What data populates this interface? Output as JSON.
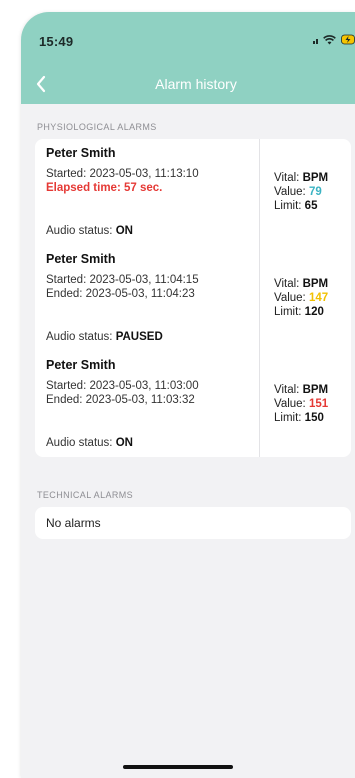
{
  "status_bar": {
    "time": "15:49"
  },
  "nav": {
    "title": "Alarm history"
  },
  "sections": {
    "physiological": "PHYSIOLOGICAL ALARMS",
    "technical": "TECHNICAL ALARMS"
  },
  "alarms": [
    {
      "name": "Peter Smith",
      "started": "Started: 2023-05-03, 11:13:10",
      "second_line": "Elapsed time: 57 sec.",
      "audio_label": "Audio status: ",
      "audio_value": "ON",
      "vital_label": "Vital: ",
      "vital": "BPM",
      "value_label": "Value: ",
      "value": "79",
      "value_color": "#3bb3c3",
      "limit_label": "Limit: ",
      "limit": "65"
    },
    {
      "name": "Peter Smith",
      "started": "Started: 2023-05-03, 11:04:15",
      "second_line": "Ended: 2023-05-03, 11:04:23",
      "audio_label": "Audio status: ",
      "audio_value": "PAUSED",
      "vital_label": "Vital: ",
      "vital": "BPM",
      "value_label": "Value: ",
      "value": "147",
      "value_color": "#f2c100",
      "limit_label": "Limit: ",
      "limit": "120"
    },
    {
      "name": "Peter Smith",
      "started": "Started: 2023-05-03, 11:03:00",
      "second_line": "Ended: 2023-05-03, 11:03:32",
      "audio_label": "Audio status: ",
      "audio_value": "ON",
      "vital_label": "Vital: ",
      "vital": "BPM",
      "value_label": "Value: ",
      "value": "151",
      "value_color": "#e53935",
      "limit_label": "Limit: ",
      "limit": "150"
    }
  ],
  "technical": {
    "empty_text": "No alarms"
  },
  "colors": {
    "header_bg": "#8fd1c2",
    "page_bg": "#f2f2f4",
    "elapsed": "#e53935"
  },
  "icons": {
    "back": "chevron-left-icon",
    "signal": "cellular-signal-icon",
    "wifi": "wifi-icon",
    "battery": "battery-charging-icon"
  }
}
